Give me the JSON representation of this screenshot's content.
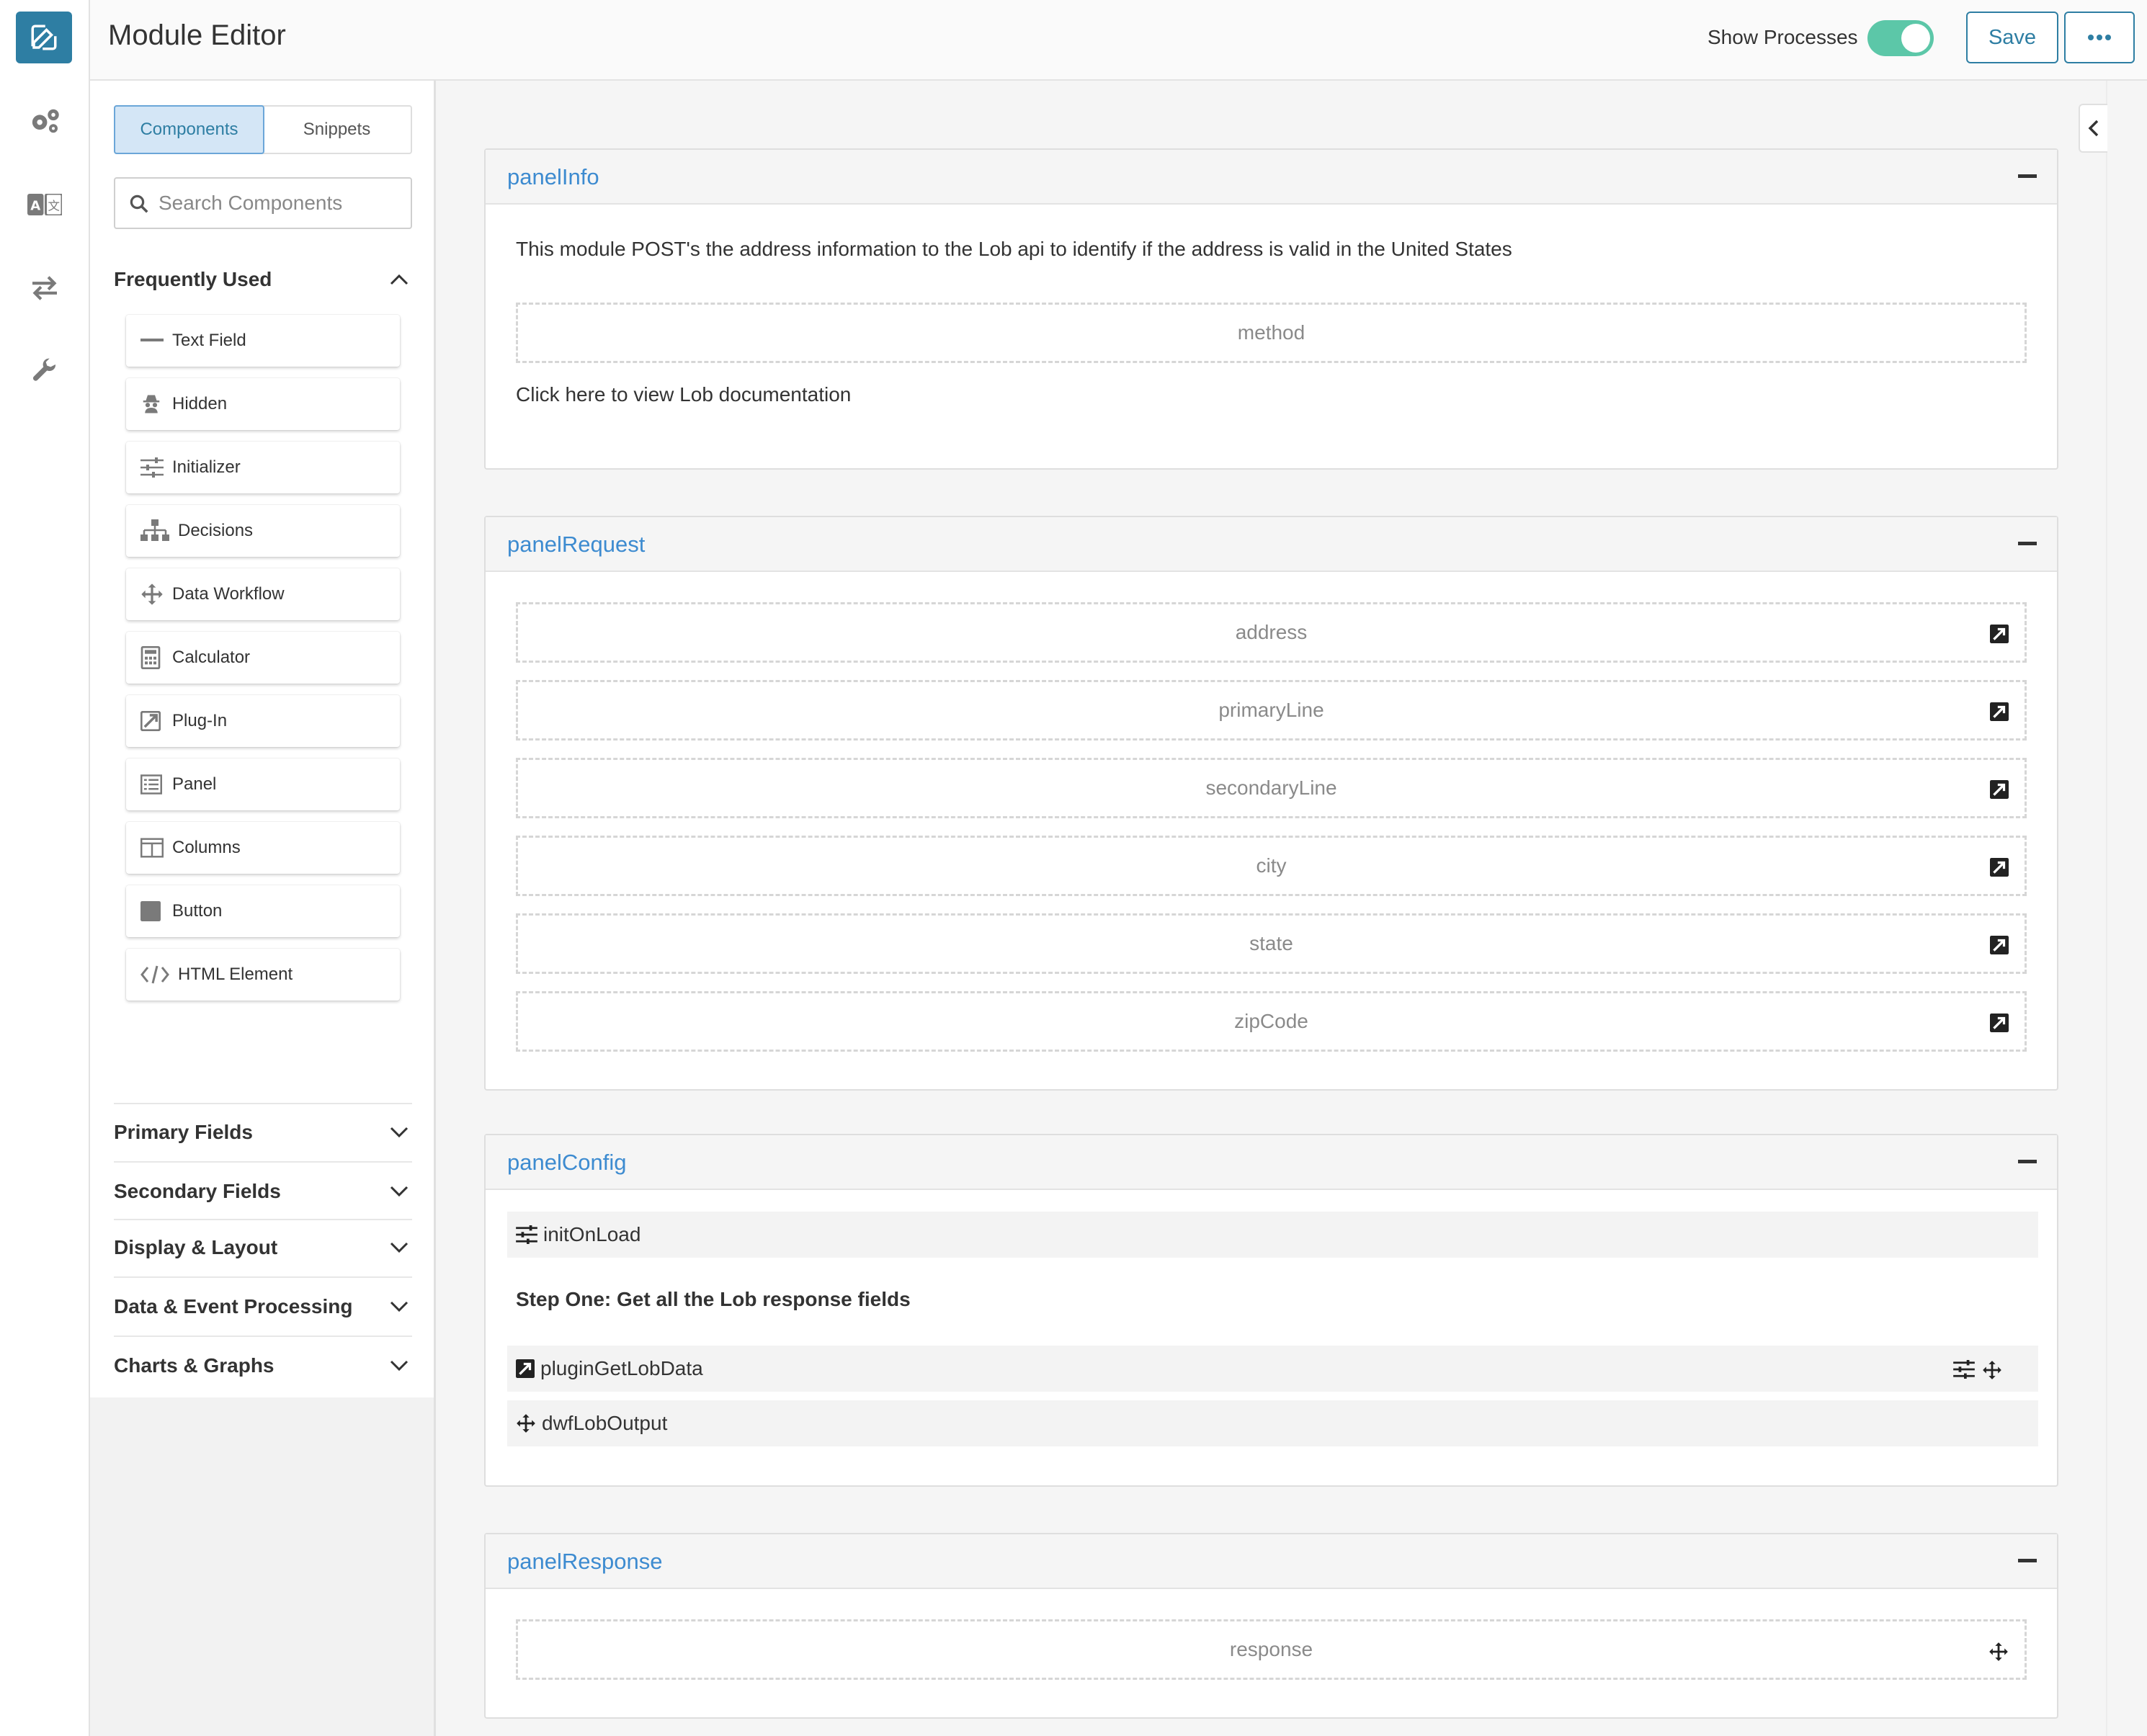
{
  "header": {
    "title": "Module Editor",
    "show_processes_label": "Show Processes",
    "show_processes_on": true,
    "save_label": "Save",
    "more_label": "•••"
  },
  "rail": {
    "items": [
      "edit-icon",
      "settings-icon",
      "translation-icon",
      "swap-icon",
      "wrench-icon"
    ]
  },
  "left_panel": {
    "tabs": [
      {
        "label": "Components",
        "active": true
      },
      {
        "label": "Snippets",
        "active": false
      }
    ],
    "search_placeholder": "Search Components",
    "sections": {
      "frequently_used": {
        "label": "Frequently Used",
        "expanded": true,
        "items": [
          {
            "label": "Text Field",
            "icon": "text-field-icon"
          },
          {
            "label": "Hidden",
            "icon": "hidden-icon"
          },
          {
            "label": "Initializer",
            "icon": "initializer-icon"
          },
          {
            "label": "Decisions",
            "icon": "decisions-icon"
          },
          {
            "label": "Data Workflow",
            "icon": "data-workflow-icon"
          },
          {
            "label": "Calculator",
            "icon": "calculator-icon"
          },
          {
            "label": "Plug-In",
            "icon": "plug-in-icon"
          },
          {
            "label": "Panel",
            "icon": "panel-icon"
          },
          {
            "label": "Columns",
            "icon": "columns-icon"
          },
          {
            "label": "Button",
            "icon": "button-icon"
          },
          {
            "label": "HTML Element",
            "icon": "html-element-icon"
          }
        ]
      },
      "collapsed": [
        {
          "label": "Primary Fields"
        },
        {
          "label": "Secondary Fields"
        },
        {
          "label": "Display & Layout"
        },
        {
          "label": "Data & Event Processing"
        },
        {
          "label": "Charts & Graphs"
        }
      ]
    }
  },
  "panels": {
    "info": {
      "title": "panelInfo",
      "description": "This module POST's the address information to the Lob api to identify if the address is valid in the United States",
      "method_field": "method",
      "link_text": "Click here to view Lob documentation"
    },
    "request": {
      "title": "panelRequest",
      "fields": [
        "address",
        "primaryLine",
        "secondaryLine",
        "city",
        "state",
        "zipCode"
      ]
    },
    "config": {
      "title": "panelConfig",
      "init": "initOnLoad",
      "step_text": "Step One: Get all the Lob response fields",
      "plugin": "pluginGetLobData",
      "workflow": "dwfLobOutput"
    },
    "response": {
      "title": "panelResponse",
      "field": "response"
    }
  },
  "colors": {
    "accent": "#2e7ea3",
    "link": "#3d8bd0",
    "toggle": "#5cc7a8"
  }
}
